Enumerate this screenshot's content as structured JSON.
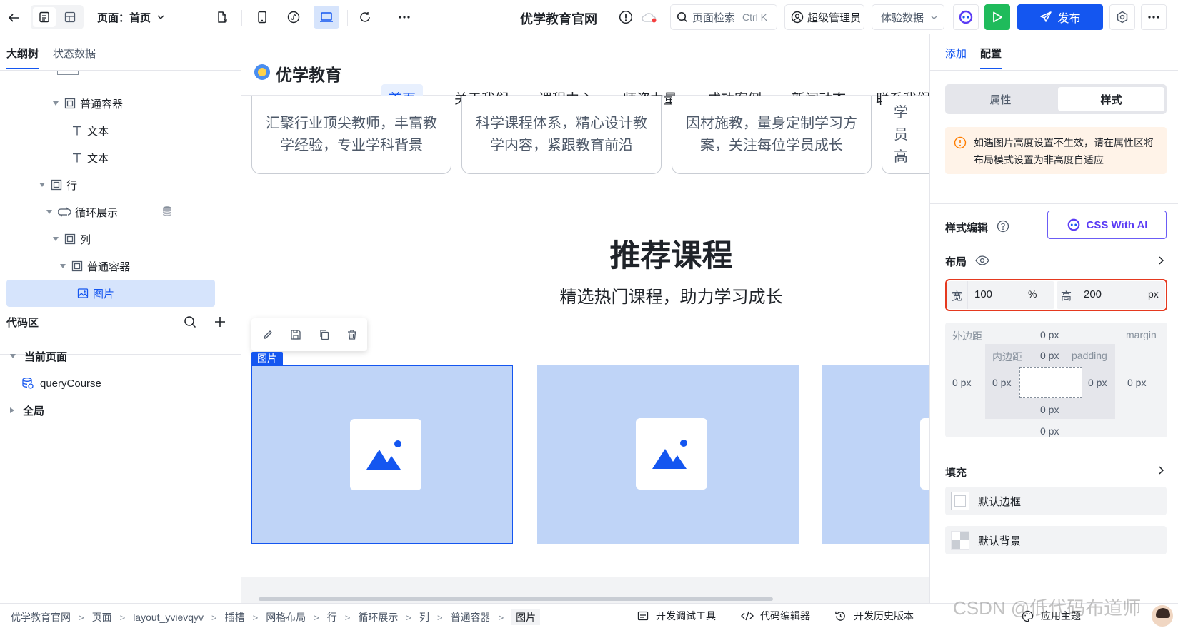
{
  "topbar": {
    "page_label": "页面：首页",
    "site_title": "优学教育官网",
    "search_label": "页面检索",
    "search_shortcut": "Ctrl K",
    "user_label": "超级管理员",
    "data_mode": "体验数据",
    "publish_label": "发布"
  },
  "left": {
    "tabs": [
      "大纲树",
      "状态数据"
    ],
    "tree": [
      {
        "label": "普通容器",
        "icon": "container-icon"
      },
      {
        "label": "文本",
        "icon": "text-icon"
      },
      {
        "label": "文本",
        "icon": "text-icon"
      },
      {
        "label": "行",
        "icon": "container-icon"
      },
      {
        "label": "循环展示",
        "icon": "loop-icon"
      },
      {
        "label": "列",
        "icon": "container-icon"
      },
      {
        "label": "普通容器",
        "icon": "container-icon"
      },
      {
        "label": "图片",
        "icon": "image-icon"
      }
    ],
    "code_title": "代码区",
    "code_tree": {
      "current_page": "当前页面",
      "query": "queryCourse",
      "global": "全局"
    }
  },
  "canvas": {
    "brand": "优学教育",
    "nav": [
      "首页",
      "关于我们",
      "课程中心",
      "师资力量",
      "成功案例",
      "新闻动态",
      "联系我们"
    ],
    "cards": [
      "汇聚行业顶尖教师，丰富教学经验，专业学科背景",
      "科学课程体系，精心设计教学内容，紧跟教育前沿",
      "因材施教，量身定制学习方案，关注每位学员成长",
      "学员高"
    ],
    "section_title": "推荐课程",
    "section_subtitle": "精选热门课程，助力学习成长",
    "selected_tag": "图片"
  },
  "right": {
    "tabs": [
      "添加",
      "配置"
    ],
    "segments": [
      "属性",
      "样式"
    ],
    "warning": "如遇图片高度设置不生效，请在属性区将布局模式设置为非高度自适应",
    "style_edit": "样式编辑",
    "css_ai": "CSS With AI",
    "layout_label": "布局",
    "width_label": "宽",
    "width_value": "100",
    "width_unit": "%",
    "height_label": "高",
    "height_value": "200",
    "height_unit": "px",
    "margin_label": "外边距",
    "margin_en": "margin",
    "padding_label": "内边距",
    "padding_en": "padding",
    "zero_px": "0 px",
    "fill_label": "填充",
    "border_default": "默认边框",
    "bg_default": "默认背景"
  },
  "bottom": {
    "breadcrumb": [
      "优学教育官网",
      "页面",
      "layout_yvievqyv",
      "插槽",
      "网格布局",
      "行",
      "循环展示",
      "列",
      "普通容器",
      "图片"
    ],
    "tools": [
      "开发调试工具",
      "代码编辑器",
      "开发历史版本"
    ],
    "theme": "应用主题",
    "watermark": "CSDN @低代码布道师"
  },
  "colors": {
    "accent": "#1456f0",
    "run": "#1fbb5b",
    "selected": "#bfd4f7",
    "warning_bg": "#fff3e8",
    "warning_icon": "#ff7d00",
    "outline_red": "#e5391f"
  }
}
